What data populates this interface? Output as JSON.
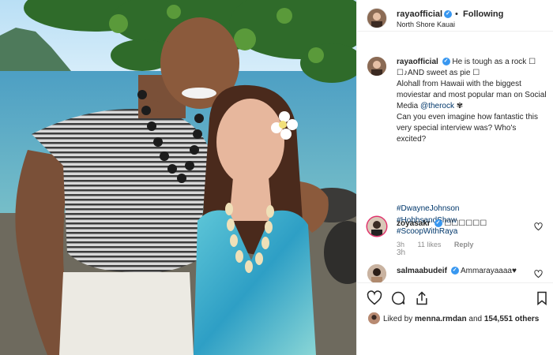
{
  "post": {
    "author": "rayaofficial",
    "follow_separator": "•",
    "follow_status": "Following",
    "location": "North Shore Kauai",
    "caption_line1": "He is tough as a rock",
    "caption_line2": "AND sweet as pie",
    "caption_line3": "Alohall from Hawaii with the biggest moviestar and most popular man on Social Media",
    "caption_mention": "@therock",
    "caption_line4": "Can you even imagine how fantastic this very special interview was? Who's excited?",
    "hashtags": [
      "#DwayneJohnson",
      "#HobbsandShaw",
      "#ScoopWithRaya"
    ],
    "timestamp": "3h"
  },
  "comments": [
    {
      "user": "zoyasakr",
      "text": "☐☐☐☐☐☐",
      "time": "3h",
      "likes": "11 likes",
      "reply": "Reply"
    },
    {
      "user": "salmaabudeif",
      "text": "Ammarayaaaa♥"
    }
  ],
  "likes": {
    "prefix": "Liked by",
    "user": "menna.rmdan",
    "middle": "and",
    "count": "154,551 others"
  },
  "icons": [
    "verified-badge-icon",
    "heart-icon",
    "comment-icon",
    "share-icon",
    "bookmark-icon"
  ],
  "colors": {
    "link": "#00376b",
    "verified": "#3897f0",
    "muted": "#8e8e8e"
  }
}
